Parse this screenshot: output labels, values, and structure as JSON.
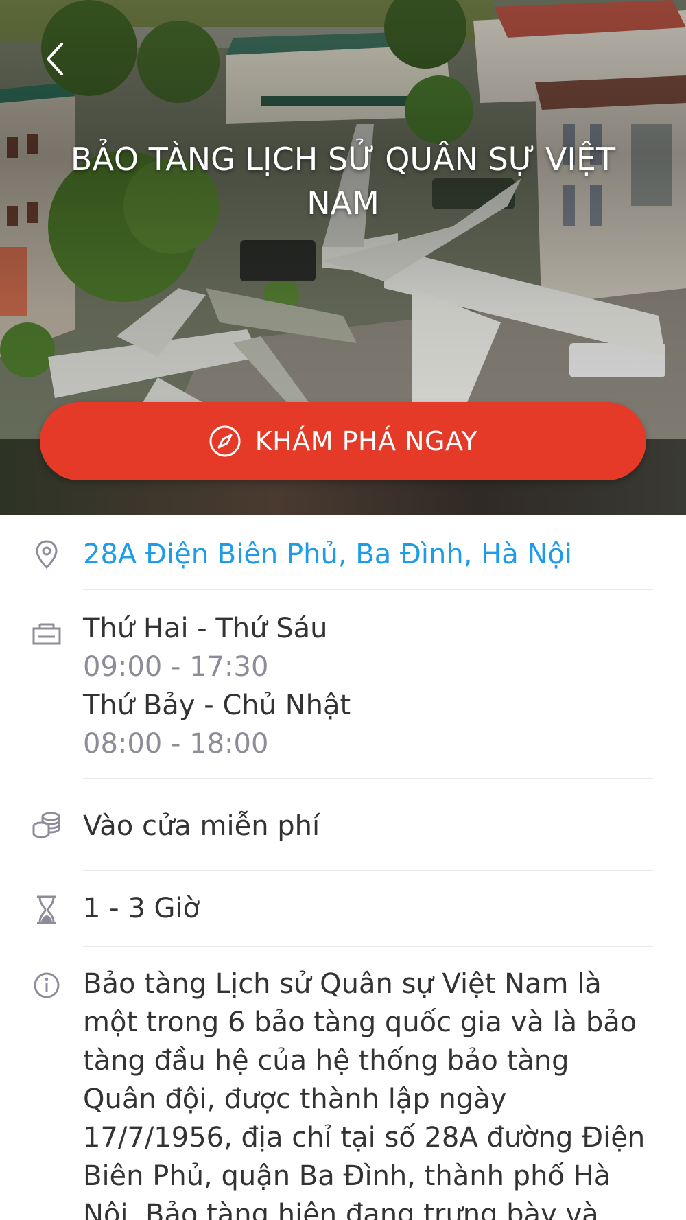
{
  "header": {
    "title": "BẢO TÀNG LỊCH SỬ QUÂN SỰ VIỆT NAM",
    "back_icon": "chevron-left-icon"
  },
  "cta": {
    "label": "KHÁM PHÁ NGAY",
    "icon": "compass-icon",
    "color": "#e53a28"
  },
  "info": {
    "address": {
      "icon": "location-pin-icon",
      "text": "28A Điện Biên Phủ, Ba Đình, Hà Nội",
      "color": "#1e9be9"
    },
    "hours": {
      "icon": "ticket-counter-icon",
      "schedule": [
        {
          "days": "Thứ Hai - Thứ Sáu",
          "time": "09:00 - 17:30"
        },
        {
          "days": "Thứ Bảy - Chủ Nhật",
          "time": "08:00 - 18:00"
        }
      ]
    },
    "price": {
      "icon": "coins-icon",
      "text": "Vào cửa miễn phí"
    },
    "duration": {
      "icon": "hourglass-icon",
      "text": "1 - 3 Giờ"
    },
    "description": {
      "icon": "info-icon",
      "text": "Bảo tàng Lịch sử Quân sự Việt Nam là một trong 6 bảo tàng quốc gia và là bảo tàng đầu hệ của hệ thống bảo tàng Quân đội, được thành lập ngày 17/7/1956, địa chỉ tại số 28A đường Điện Biên Phủ, quận Ba Đình, thành phố Hà Nội. Bảo tàng hiện đang trưng bày và lưu giữ hàng vạn hiện"
    }
  }
}
